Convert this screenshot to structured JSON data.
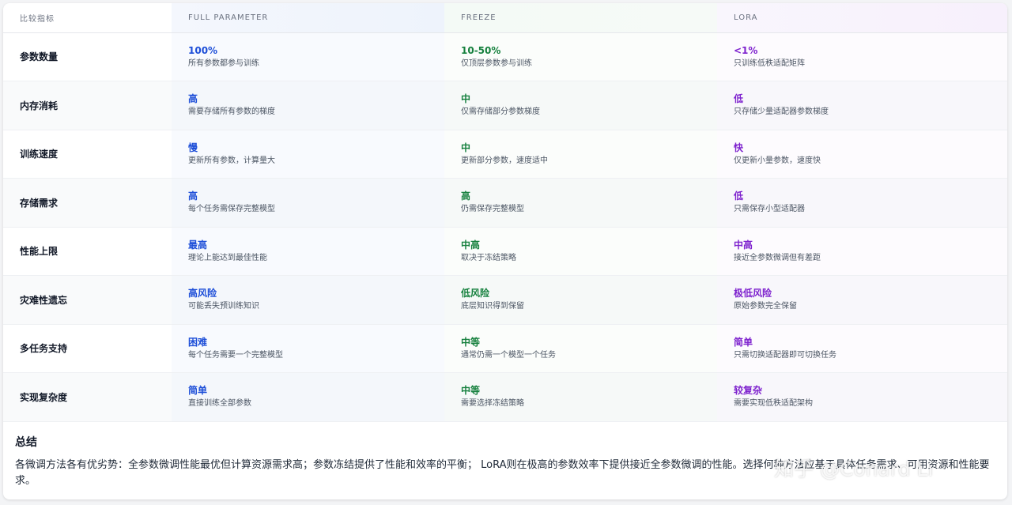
{
  "colors": {
    "full_parameter": "#1d4ed8",
    "freeze": "#15803d",
    "lora": "#7e22ce"
  },
  "table": {
    "headers": [
      "比较指标",
      "FULL PARAMETER",
      "FREEZE",
      "LORA"
    ],
    "rows": [
      {
        "metric": "参数数量",
        "full": {
          "main": "100%",
          "sub": "所有参数都参与训练"
        },
        "freeze": {
          "main": "10-50%",
          "sub": "仅顶层参数参与训练"
        },
        "lora": {
          "main": "<1%",
          "sub": "只训练低秩适配矩阵"
        }
      },
      {
        "metric": "内存消耗",
        "full": {
          "main": "高",
          "sub": "需要存储所有参数的梯度"
        },
        "freeze": {
          "main": "中",
          "sub": "仅需存储部分参数梯度"
        },
        "lora": {
          "main": "低",
          "sub": "只存储少量适配器参数梯度"
        }
      },
      {
        "metric": "训练速度",
        "full": {
          "main": "慢",
          "sub": "更新所有参数，计算量大"
        },
        "freeze": {
          "main": "中",
          "sub": "更新部分参数，速度适中"
        },
        "lora": {
          "main": "快",
          "sub": "仅更新小量参数，速度快"
        }
      },
      {
        "metric": "存储需求",
        "full": {
          "main": "高",
          "sub": "每个任务需保存完整模型"
        },
        "freeze": {
          "main": "高",
          "sub": "仍需保存完整模型"
        },
        "lora": {
          "main": "低",
          "sub": "只需保存小型适配器"
        }
      },
      {
        "metric": "性能上限",
        "full": {
          "main": "最高",
          "sub": "理论上能达到最佳性能"
        },
        "freeze": {
          "main": "中高",
          "sub": "取决于冻结策略"
        },
        "lora": {
          "main": "中高",
          "sub": "接近全参数微调但有差距"
        }
      },
      {
        "metric": "灾难性遗忘",
        "full": {
          "main": "高风险",
          "sub": "可能丢失预训练知识"
        },
        "freeze": {
          "main": "低风险",
          "sub": "底层知识得到保留"
        },
        "lora": {
          "main": "极低风险",
          "sub": "原始参数完全保留"
        }
      },
      {
        "metric": "多任务支持",
        "full": {
          "main": "困难",
          "sub": "每个任务需要一个完整模型"
        },
        "freeze": {
          "main": "中等",
          "sub": "通常仍需一个模型一个任务"
        },
        "lora": {
          "main": "简单",
          "sub": "只需切换适配器即可切换任务"
        }
      },
      {
        "metric": "实现复杂度",
        "full": {
          "main": "简单",
          "sub": "直接训练全部参数"
        },
        "freeze": {
          "main": "中等",
          "sub": "需要选择冻结策略"
        },
        "lora": {
          "main": "较复杂",
          "sub": "需要实现低秩适配架构"
        }
      }
    ]
  },
  "summary": {
    "title": "总结",
    "text": "各微调方法各有优劣势：全参数微调性能最优但计算资源需求高；参数冻结提供了性能和效率的平衡； LoRA则在极高的参数效率下提供接近全参数微调的性能。选择何种方法应基于具体任务需求、可用资源和性能要求。"
  },
  "watermark": "知乎 @Conard Li"
}
